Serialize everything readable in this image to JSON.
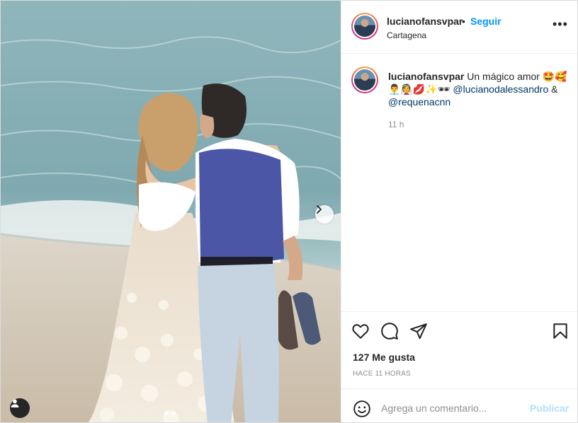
{
  "post": {
    "username": "lucianofansvpar",
    "separator": "•",
    "follow_label": "Seguir",
    "location": "Cartagena",
    "more_icon": "more-horizontal-icon"
  },
  "caption": {
    "username": "lucianofansvpar",
    "text": "Un mágico amor 🤩🥰",
    "emoji_line": "👨‍💼👰💋✨🕶",
    "mention1": "@lucianodalessandro",
    "amp": "&",
    "mention2": "@requenacnn",
    "time": "11 h"
  },
  "actions": {
    "like_icon": "heart-icon",
    "comment_icon": "comment-icon",
    "share_icon": "send-icon",
    "save_icon": "bookmark-icon"
  },
  "stats": {
    "likes": "127 Me gusta",
    "posted": "HACE 11 HORAS"
  },
  "composer": {
    "placeholder": "Agrega un comentario...",
    "publish_label": "Publicar"
  },
  "carousel": {
    "current": 1,
    "total": 2
  },
  "colors": {
    "accent": "#0095f6",
    "publish_disabled": "#b2dffc",
    "mention": "#00376b"
  }
}
